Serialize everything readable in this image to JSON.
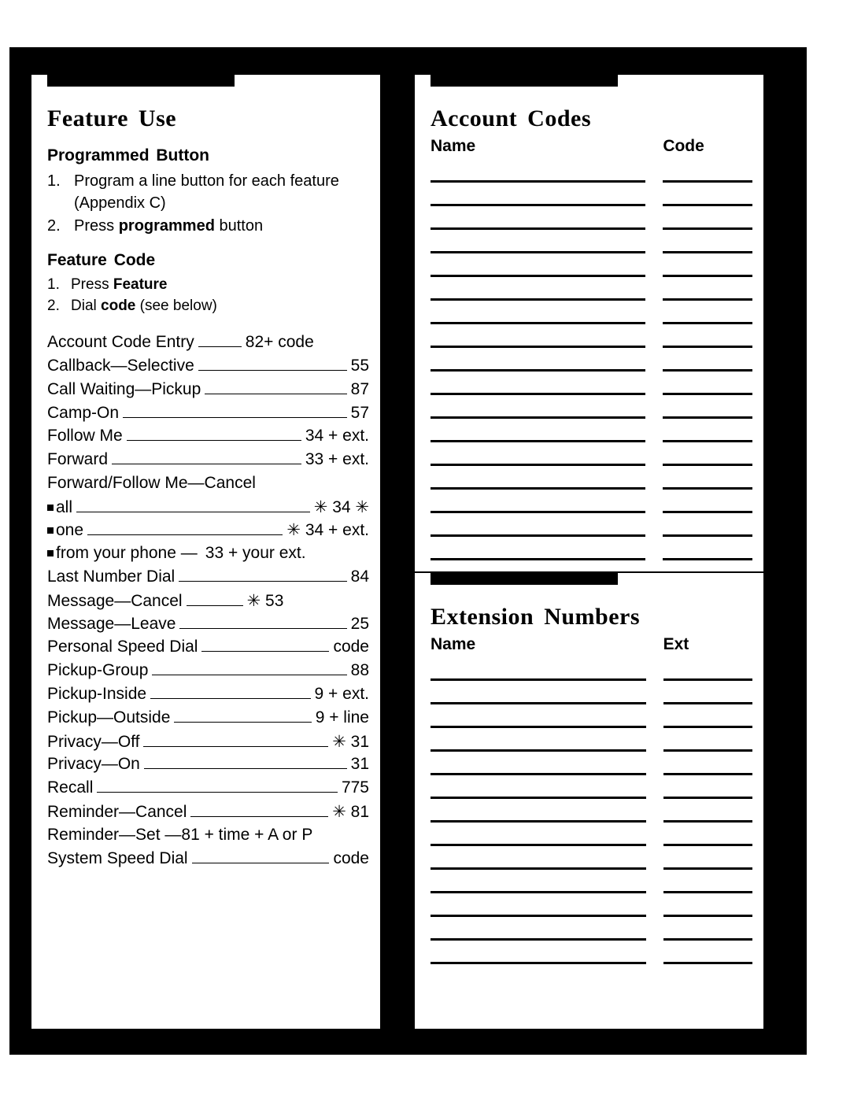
{
  "document": {
    "type": "reference-card",
    "colors": {
      "ink": "#000000",
      "paper": "#ffffff"
    }
  },
  "left_card": {
    "title": "Feature Use",
    "programmed_button": {
      "heading": "Programmed Button",
      "steps": [
        {
          "num": "1.",
          "pre": "Program a line button for each feature (Appendix C)",
          "bold": "",
          "post": ""
        },
        {
          "num": "2.",
          "pre": "Press ",
          "bold": "programmed",
          "post": " button"
        }
      ]
    },
    "feature_code": {
      "heading": "Feature Code",
      "steps": [
        {
          "num": "1.",
          "pre": "Press ",
          "bold": "Feature",
          "post": ""
        },
        {
          "num": "2.",
          "pre": "Dial ",
          "bold": "code",
          "post": " (see below)"
        }
      ]
    },
    "codes": [
      {
        "label": "Account Code Entry",
        "value": "82+ code",
        "leader": true,
        "bullet": false,
        "leader_flex": "0 0 55px"
      },
      {
        "label": "Callback—Selective",
        "value": "55",
        "leader": true,
        "bullet": false
      },
      {
        "label": "Call Waiting—Pickup",
        "value": "87",
        "leader": true,
        "bullet": false
      },
      {
        "label": "Camp-On",
        "value": "57",
        "leader": true,
        "bullet": false
      },
      {
        "label": "Follow Me",
        "value": "34 + ext.",
        "leader": true,
        "bullet": false
      },
      {
        "label": "Forward",
        "value": "33 + ext.",
        "leader": true,
        "bullet": false
      },
      {
        "label": "Forward/Follow Me—Cancel",
        "value": "",
        "leader": false,
        "bullet": false
      },
      {
        "label": "all",
        "value": "✳ 34 ✳",
        "leader": true,
        "bullet": true
      },
      {
        "label": "one",
        "value": "✳ 34 + ext.",
        "leader": true,
        "bullet": true
      },
      {
        "label": "from your phone —",
        "value": "33 + your ext.",
        "leader": false,
        "bullet": true
      },
      {
        "label": "Last Number Dial",
        "value": "84",
        "leader": true,
        "bullet": false
      },
      {
        "label": "Message—Cancel",
        "value": "✳ 53",
        "leader": true,
        "bullet": false,
        "leader_flex": "0 0 72px"
      },
      {
        "label": "Message—Leave",
        "value": "25",
        "leader": true,
        "bullet": false
      },
      {
        "label": "Personal Speed Dial",
        "value": "code",
        "leader": true,
        "bullet": false
      },
      {
        "label": "Pickup-Group",
        "value": "88",
        "leader": true,
        "bullet": false
      },
      {
        "label": "Pickup-Inside",
        "value": "9 + ext.",
        "leader": true,
        "bullet": false
      },
      {
        "label": "Pickup—Outside",
        "value": "9 + line",
        "leader": true,
        "bullet": false
      },
      {
        "label": "Privacy—Off",
        "value": "✳ 31",
        "leader": true,
        "bullet": false
      },
      {
        "label": "Privacy—On",
        "value": "31",
        "leader": true,
        "bullet": false
      },
      {
        "label": "Recall",
        "value": "775",
        "leader": true,
        "bullet": false
      },
      {
        "label": "Reminder—Cancel",
        "value": "✳ 81",
        "leader": true,
        "bullet": false
      },
      {
        "label": "Reminder—Set —81 + time + A or P",
        "value": "",
        "leader": false,
        "bullet": false
      },
      {
        "label": "System Speed Dial",
        "value": "code",
        "leader": true,
        "bullet": false
      }
    ]
  },
  "right_card": {
    "account_codes": {
      "title": "Account Codes",
      "col_name": "Name",
      "col_code": "Code",
      "row_count": 17
    },
    "extension_numbers": {
      "title": "Extension Numbers",
      "col_name": "Name",
      "col_ext": "Ext",
      "row_count": 13
    }
  }
}
